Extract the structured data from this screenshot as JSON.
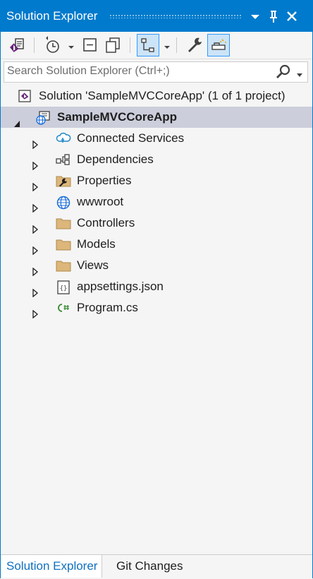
{
  "window": {
    "title": "Solution Explorer",
    "accent_color": "#007acc",
    "selection_color": "#cccedb",
    "title_buttons": [
      "dropdown-icon",
      "pin-icon",
      "close-icon"
    ]
  },
  "toolbar": {
    "items": [
      "vs-home-icon",
      "history-icon",
      "collapse-all-icon",
      "show-all-files-icon",
      "view-tree-icon",
      "properties-wrench-icon",
      "preview-selected-icon"
    ]
  },
  "search": {
    "placeholder": "Search Solution Explorer (Ctrl+;)"
  },
  "tree": {
    "solution": {
      "label": "Solution 'SampleMVCCoreApp' (1 of 1 project)"
    },
    "project": {
      "label": "SampleMVCCoreApp",
      "expanded": true,
      "selected": true
    },
    "items": [
      {
        "label": "Connected Services",
        "icon": "connected-services-icon"
      },
      {
        "label": "Dependencies",
        "icon": "dependencies-icon"
      },
      {
        "label": "Properties",
        "icon": "properties-icon"
      },
      {
        "label": "wwwroot",
        "icon": "globe-icon"
      },
      {
        "label": "Controllers",
        "icon": "folder-icon"
      },
      {
        "label": "Models",
        "icon": "folder-icon"
      },
      {
        "label": "Views",
        "icon": "folder-icon"
      },
      {
        "label": "appsettings.json",
        "icon": "json-file-icon"
      },
      {
        "label": "Program.cs",
        "icon": "csharp-file-icon"
      }
    ]
  },
  "tabs": [
    {
      "label": "Solution Explorer",
      "active": true
    },
    {
      "label": "Git Changes",
      "active": false
    }
  ]
}
